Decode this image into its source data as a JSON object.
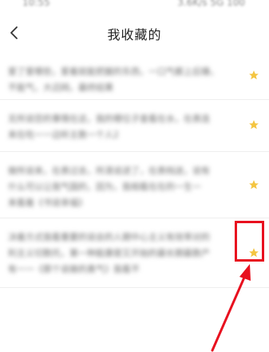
{
  "status_bar": {
    "time": "10:55",
    "right": "3.6K/s 5G 100"
  },
  "nav": {
    "back_icon": "chevron-left-icon",
    "title": "我收藏的"
  },
  "favorites": [
    {
      "text": [
        "爱了爱哪些，爱着就能把握的东西，一口气都上后锤，",
        "不能气，大迈网，最终结果"
      ],
      "starred": true
    },
    {
      "text": [
        "无所说您的事情在这，我的哪位子查看在水，在表连",
        "来在吃一一边听主数一个人2"
      ],
      "starred": true
    },
    {
      "text": [
        "做所说来，在表过去，所清说进了，在表档送，说有",
        "什么可以让我气国的，因为，我相看在在的一生一",
        "来看着《书说幸福》"
      ],
      "starred": true
    },
    {
      "text": [
        "决着方式我看重要的说会的人期中心主义有效率对的",
        "利主义切数托，第一种能康是又开始的最长期最数产",
        "有一一《那个说做的勇气》我看不"
      ],
      "starred": true
    }
  ],
  "colors": {
    "star": "#f4c542",
    "highlight": "#e8101f"
  }
}
